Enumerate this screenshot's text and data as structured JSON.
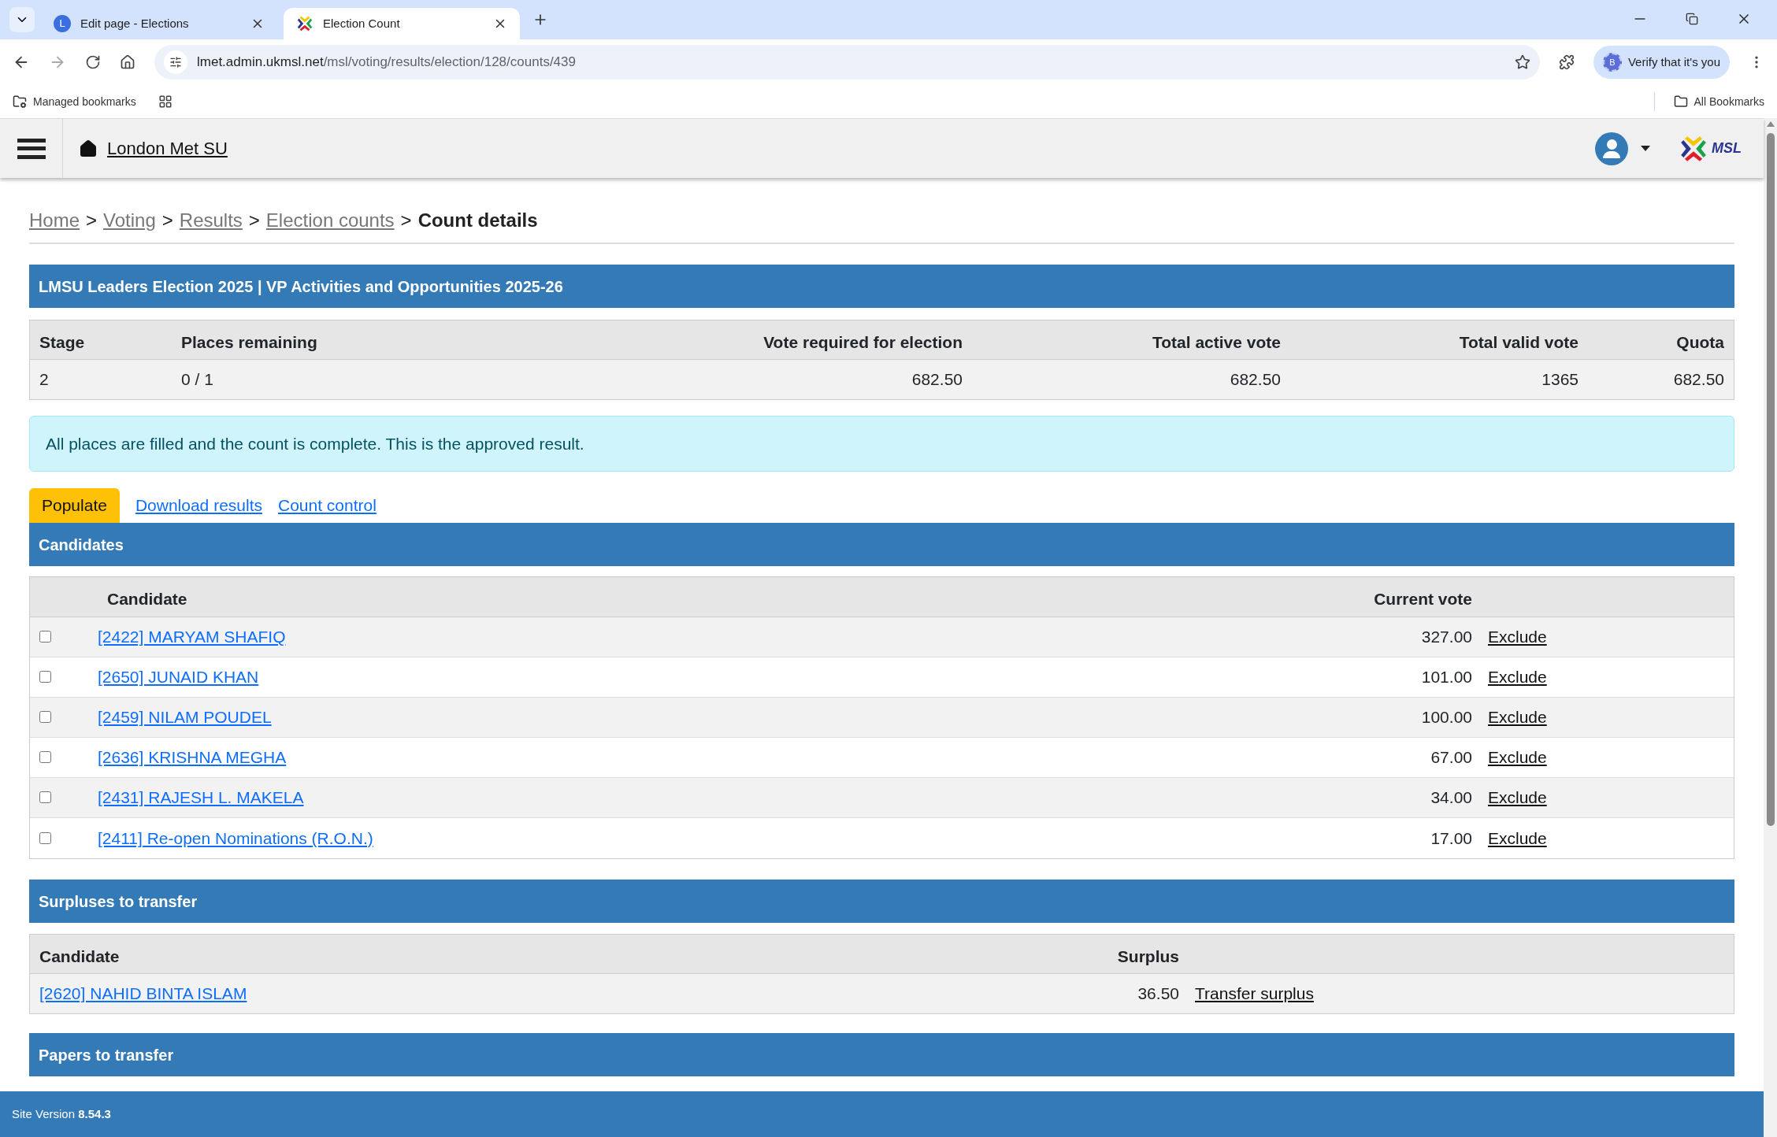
{
  "browser": {
    "tabs": [
      {
        "title": "Edit page - Elections",
        "selected": false,
        "kind": "letter",
        "letter": "L"
      },
      {
        "title": "Election Count",
        "selected": true,
        "kind": "logo"
      }
    ],
    "url_host": "lmet.admin.ukmsl.net",
    "url_path": "/msl/voting/results/election/128/counts/439",
    "profile_letter": "B",
    "verify_label": "Verify that it's you",
    "bookmarks": [
      "Managed bookmarks"
    ],
    "all_bookmarks": "All Bookmarks"
  },
  "site": {
    "name": "London Met SU",
    "logo_text": "MSL"
  },
  "breadcrumb": [
    {
      "label": "Home",
      "current": false
    },
    {
      "label": "Voting",
      "current": false
    },
    {
      "label": "Results",
      "current": false
    },
    {
      "label": "Election counts",
      "current": false
    },
    {
      "label": "Count details",
      "current": true
    }
  ],
  "breadcrumb_separator": ">",
  "election_title": "LMSU Leaders Election 2025 | VP Activities and Opportunities 2025-26",
  "stats": {
    "columns": [
      "Stage",
      "Places remaining",
      "Vote required for election",
      "Total active vote",
      "Total valid vote",
      "Quota"
    ],
    "row": [
      "2",
      "0 / 1",
      "682.50",
      "682.50",
      "1365",
      "682.50"
    ]
  },
  "alert": "All places are filled and the count is complete. This is the approved result.",
  "actions": [
    {
      "kind": "button",
      "label": "Populate"
    },
    {
      "kind": "link",
      "label": "Download results"
    },
    {
      "kind": "link",
      "label": "Count control"
    }
  ],
  "candidates": {
    "title": "Candidates",
    "columns": [
      "Candidate",
      "Current vote"
    ],
    "rows": [
      {
        "checked": false,
        "name": "[2422] MARYAM SHAFIQ",
        "vote": "327.00",
        "action": "Exclude"
      },
      {
        "checked": false,
        "name": "[2650] JUNAID KHAN",
        "vote": "101.00",
        "action": "Exclude"
      },
      {
        "checked": false,
        "name": "[2459] NILAM POUDEL",
        "vote": "100.00",
        "action": "Exclude"
      },
      {
        "checked": false,
        "name": "[2636] KRISHNA MEGHA",
        "vote": "67.00",
        "action": "Exclude"
      },
      {
        "checked": false,
        "name": "[2431] RAJESH L. MAKELA",
        "vote": "34.00",
        "action": "Exclude"
      },
      {
        "checked": false,
        "name": "[2411] Re-open Nominations (R.O.N.)",
        "vote": "17.00",
        "action": "Exclude"
      }
    ]
  },
  "surpluses": {
    "title": "Surpluses to transfer",
    "columns": [
      "Candidate",
      "Surplus"
    ],
    "rows": [
      {
        "name": "[2620] NAHID BINTA ISLAM",
        "surplus": "36.50",
        "action": "Transfer surplus"
      }
    ]
  },
  "papers": {
    "title": "Papers to transfer"
  },
  "footer": "Site Version **8.54.3**"
}
